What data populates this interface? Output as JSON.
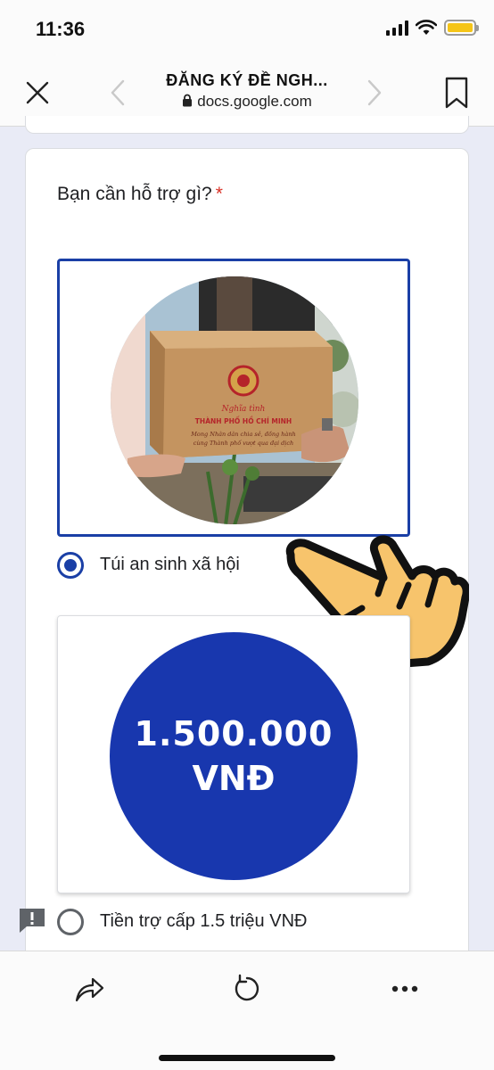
{
  "status_bar": {
    "time": "11:36",
    "icons": [
      "signal-icon",
      "wifi-icon",
      "battery-icon"
    ],
    "battery_color": "#f5c518"
  },
  "browser": {
    "title": "ĐĂNG KÝ ĐỀ NGH...",
    "url": "docs.google.com",
    "icons": [
      "close-icon",
      "back-icon",
      "forward-icon",
      "bookmark-icon",
      "lock-icon"
    ]
  },
  "form": {
    "question": "Bạn cần hỗ trợ gì?",
    "required_mark": "*",
    "options": [
      {
        "label": "Túi an sinh xã hội",
        "selected": true,
        "image": {
          "box_text_line1": "Nghĩa tình",
          "box_text_line2": "THÀNH PHỐ HỒ CHÍ MINH",
          "box_text_line3": "Mong Nhân dân chia sẻ, đồng hành",
          "box_text_line4": "cùng Thành phố vượt qua đại dịch"
        }
      },
      {
        "label": "Tiền trợ cấp 1.5 triệu VNĐ",
        "selected": false,
        "image": {
          "amount": "1.500.000",
          "currency": "VNĐ"
        }
      }
    ]
  },
  "toolbar": {
    "icons": [
      "share-icon",
      "reload-icon",
      "more-icon"
    ]
  },
  "colors": {
    "accent": "#1a3fa6",
    "money_circle": "#1837ae",
    "required": "#d93025",
    "hand": "#f7c46c",
    "page_bg": "#e9ebf6"
  }
}
